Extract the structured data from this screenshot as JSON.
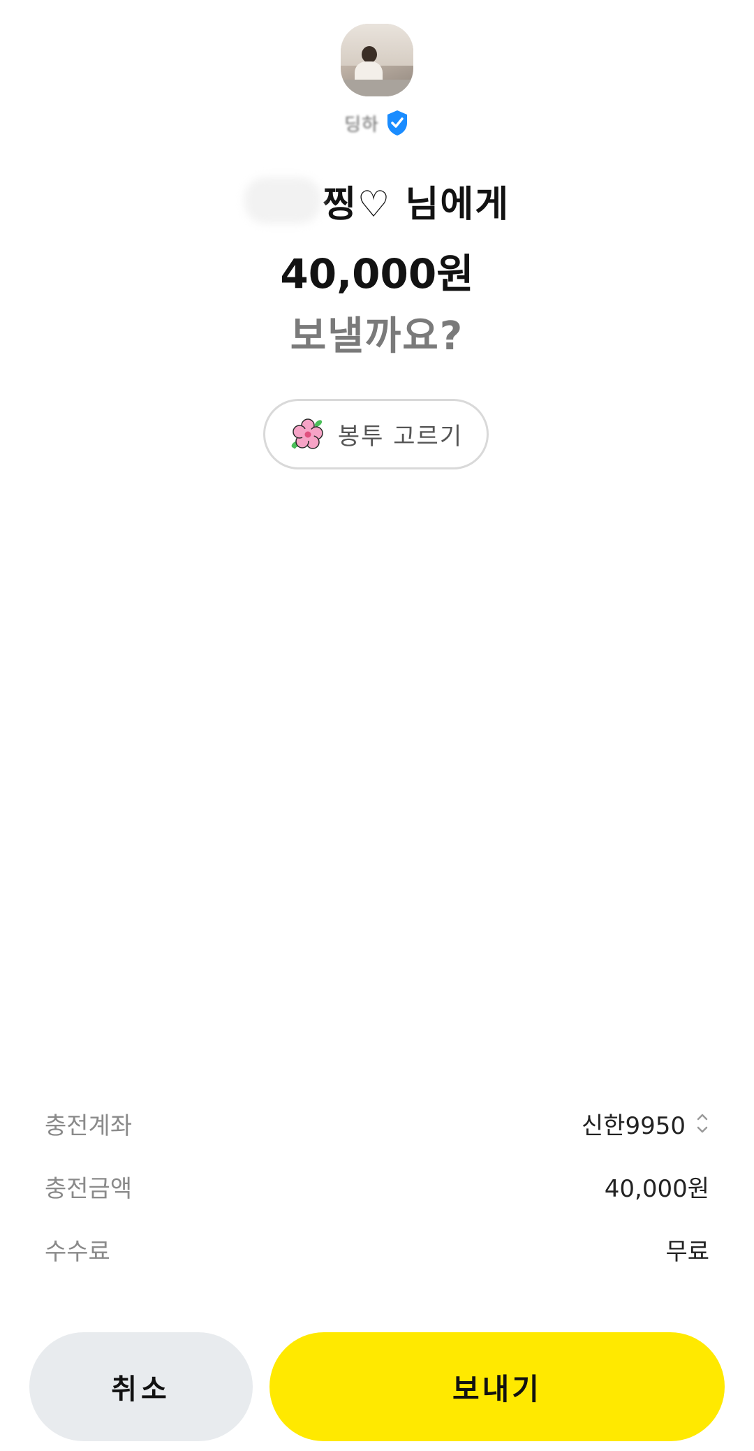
{
  "profile": {
    "name": "딩하"
  },
  "headline": {
    "recipient": "찡♡ 님에게",
    "amount": "40,000원",
    "question": "보낼까요?"
  },
  "envelope": {
    "label": "봉투 고르기"
  },
  "details": [
    {
      "label": "충전계좌",
      "value": "신한9950"
    },
    {
      "label": "충전금액",
      "value": "40,000원"
    },
    {
      "label": "수수료",
      "value": "무료"
    }
  ],
  "actions": {
    "cancel_label": "취소",
    "send_label": "보내기"
  },
  "colors": {
    "accent": "#FFE900",
    "verified": "#1A8CFF",
    "cancel_bg": "#E8EBEE"
  },
  "icons": {
    "verified": "verified-shield-icon",
    "envelope": "flower-icon",
    "account_selector": "chevron-updown-icon"
  }
}
